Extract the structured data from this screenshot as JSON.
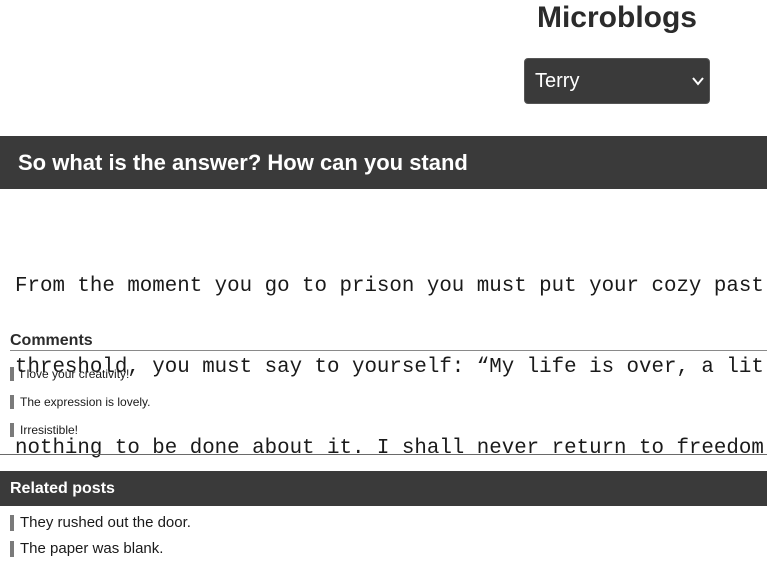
{
  "header": {
    "site_title": "Microblogs",
    "user_select": {
      "selected": "Terry",
      "options": [
        "Terry"
      ]
    }
  },
  "post": {
    "title": "So what is the answer? How can you stand",
    "body_lines": [
      "From the moment you go to prison you must put your cozy past",
      "threshold, you must say to yourself: “My life is over, a lit",
      "nothing to be done about it. I shall never return to freedom"
    ]
  },
  "comments": {
    "heading": "Comments",
    "items": [
      "I love your creativity!",
      "The expression is lovely.",
      "Irresistible!"
    ]
  },
  "related": {
    "heading": "Related posts",
    "items": [
      "They rushed out the door.",
      "The paper was blank."
    ]
  },
  "colors": {
    "bar_background": "#3a3a3a",
    "accent_bar": "#7a7a7a",
    "text": "#1a1a1a"
  }
}
